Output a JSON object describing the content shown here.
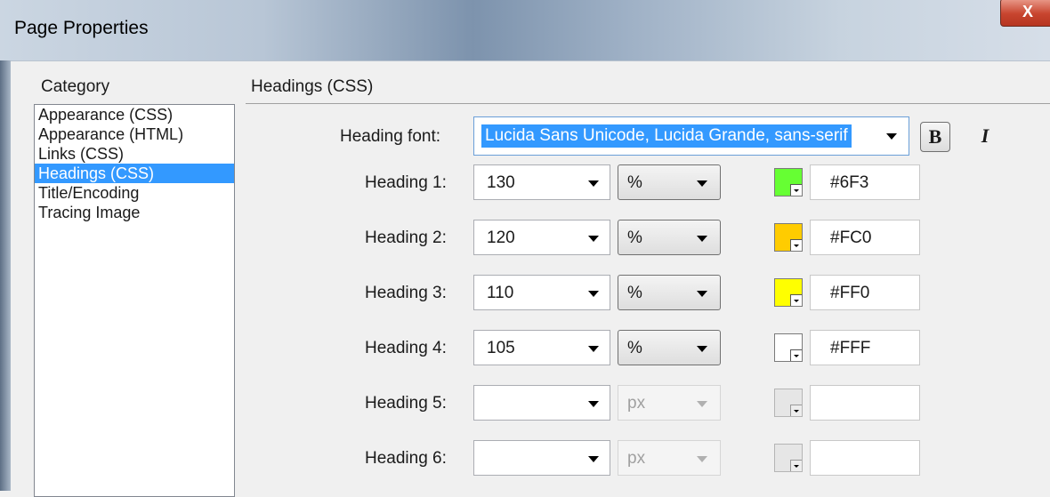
{
  "window": {
    "title": "Page Properties",
    "close_label": "X"
  },
  "category": {
    "label": "Category",
    "items": [
      {
        "label": "Appearance (CSS)",
        "selected": false
      },
      {
        "label": "Appearance (HTML)",
        "selected": false
      },
      {
        "label": "Links (CSS)",
        "selected": false
      },
      {
        "label": "Headings (CSS)",
        "selected": true
      },
      {
        "label": "Title/Encoding",
        "selected": false
      },
      {
        "label": "Tracing Image",
        "selected": false
      }
    ]
  },
  "section": {
    "title": "Headings (CSS)"
  },
  "heading_font": {
    "label": "Heading font:",
    "value": "Lucida Sans Unicode, Lucida Grande, sans-serif",
    "bold_label": "B",
    "italic_label": "I"
  },
  "headings": [
    {
      "label": "Heading 1:",
      "size": "130",
      "unit": "%",
      "color_hex": "#6F3",
      "swatch_color": "#66ff33",
      "enabled": true
    },
    {
      "label": "Heading 2:",
      "size": "120",
      "unit": "%",
      "color_hex": "#FC0",
      "swatch_color": "#ffcc00",
      "enabled": true
    },
    {
      "label": "Heading 3:",
      "size": "110",
      "unit": "%",
      "color_hex": "#FF0",
      "swatch_color": "#ffff00",
      "enabled": true
    },
    {
      "label": "Heading 4:",
      "size": "105",
      "unit": "%",
      "color_hex": "#FFF",
      "swatch_color": "#ffffff",
      "enabled": true
    },
    {
      "label": "Heading 5:",
      "size": "",
      "unit": "px",
      "color_hex": "",
      "swatch_color": "#e6e6e6",
      "enabled": false
    },
    {
      "label": "Heading 6:",
      "size": "",
      "unit": "px",
      "color_hex": "",
      "swatch_color": "#e6e6e6",
      "enabled": false
    }
  ]
}
